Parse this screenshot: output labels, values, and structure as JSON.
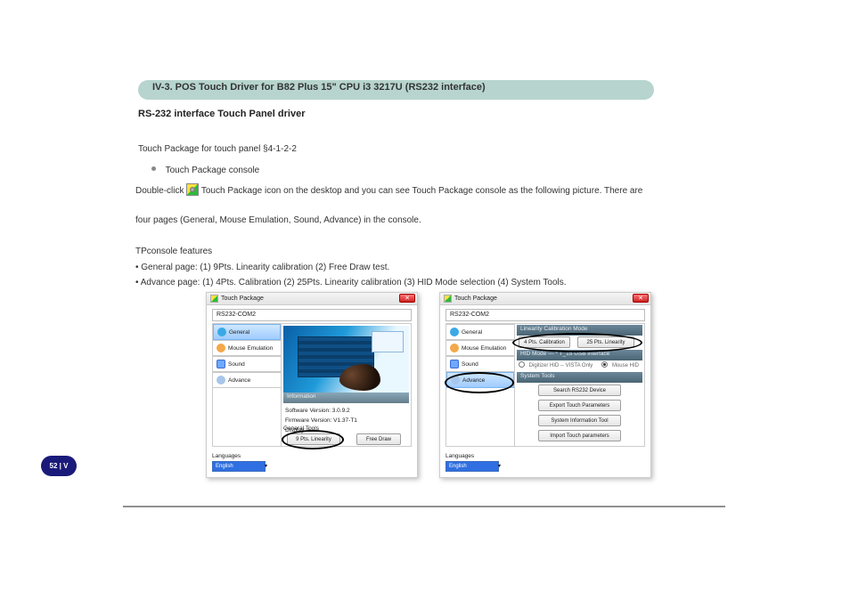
{
  "doc": {
    "header": "IV-3. POS Touch Driver for B82 Plus 15\" CPU i3 3217U  (RS232 interface)",
    "subtitle": "RS-232 interface Touch Panel driver",
    "p1": "Touch Package for touch panel  §4-1-2-2",
    "bullet": "Touch Package console",
    "p2_before_icon": "Double-click ",
    "p2_after_icon": " Touch Package icon on the desktop and you can see Touch Package console as the following picture. There are",
    "p3": "four pages (General, Mouse Emulation, Sound, Advance) in the console.",
    "p4": "TPconsole features",
    "p5": "• General page: (1) 9Pts. Linearity calibration (2) Free Draw test.",
    "p6": "• Advance page: (1) 4Pts. Calibration (2) 25Pts. Linearity calibration (3) HID Mode selection (4) System Tools."
  },
  "pill": "52 | V",
  "window": {
    "title": "Touch Package",
    "device": "RS232-COM2",
    "tabs": {
      "general": "General",
      "mouse": "Mouse Emulation",
      "sound": "Sound",
      "advance": "Advance"
    }
  },
  "left": {
    "info_bar": "Information",
    "sw": "Software Version: 3.0.9.2",
    "fw": "Firmware Version: V1.37-T1",
    "disp": "Display: 1",
    "gt_label": "General Tools",
    "btn_lin": "9 Pts. Linearity",
    "btn_draw": "Free Draw"
  },
  "right": {
    "h1": "Linearity Calibration Mode",
    "cal": "4 Pts. Calibration",
    "lin25": "25 Pts. Linearity",
    "h2": "HID Mode —  * T_15 USB interface",
    "radio1": "Digitizer HID -- VISTA Only",
    "radio2": "Mouse HID",
    "h3": "System Tools",
    "t1": "Search RS232 Device",
    "t2": "Export Touch Parameters",
    "t3": "System Information Tool",
    "t4": "Import Touch parameters"
  },
  "lang": {
    "label": "Languages",
    "value": "English"
  }
}
